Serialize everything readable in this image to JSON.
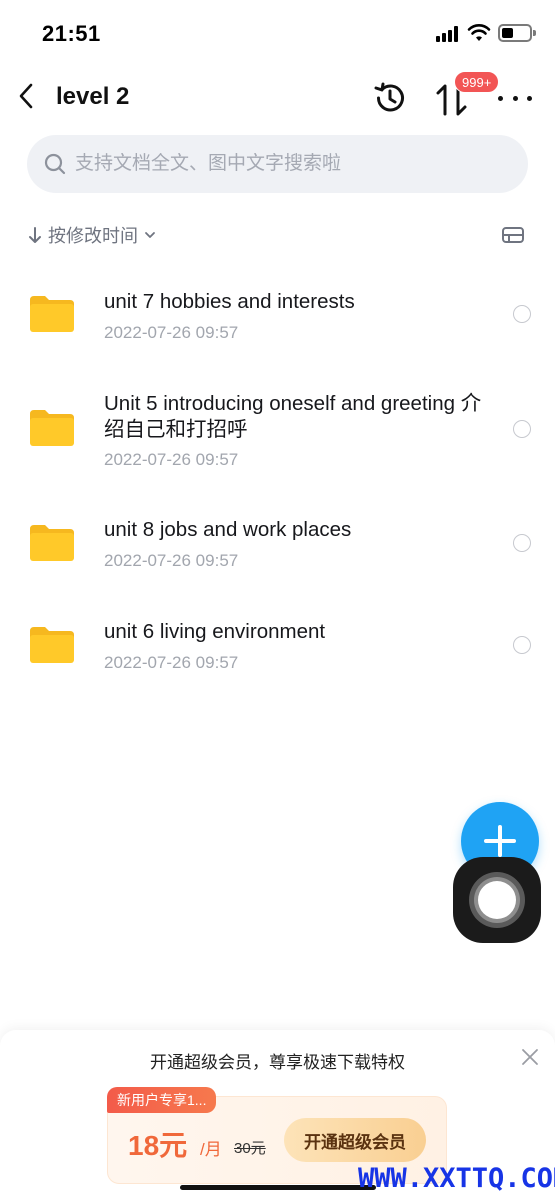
{
  "status_bar": {
    "time": "21:51"
  },
  "header": {
    "title": "level 2",
    "badge": "999+"
  },
  "search": {
    "placeholder": "支持文档全文、图中文字搜索啦"
  },
  "sort": {
    "label": "按修改时间"
  },
  "files": [
    {
      "name": "unit 7 hobbies and interests",
      "modified": "2022-07-26 09:57"
    },
    {
      "name": "Unit 5 introducing oneself and greeting 介绍自己和打招呼",
      "modified": "2022-07-26 09:57"
    },
    {
      "name": "unit 8 jobs and work places",
      "modified": "2022-07-26 09:57"
    },
    {
      "name": "unit 6 living environment",
      "modified": "2022-07-26 09:57"
    }
  ],
  "promo": {
    "title": "开通超级会员，尊享极速下载特权",
    "tag": "新用户专享1...",
    "price": "18元",
    "unit": "/月",
    "old_price": "30元",
    "button": "开通超级会员"
  },
  "watermark": "WWW.XXTTQ.COM",
  "colors": {
    "accent": "#1fa3f4",
    "badge": "#f25555",
    "folder": "#ffc929",
    "promo_price": "#f0683a"
  }
}
